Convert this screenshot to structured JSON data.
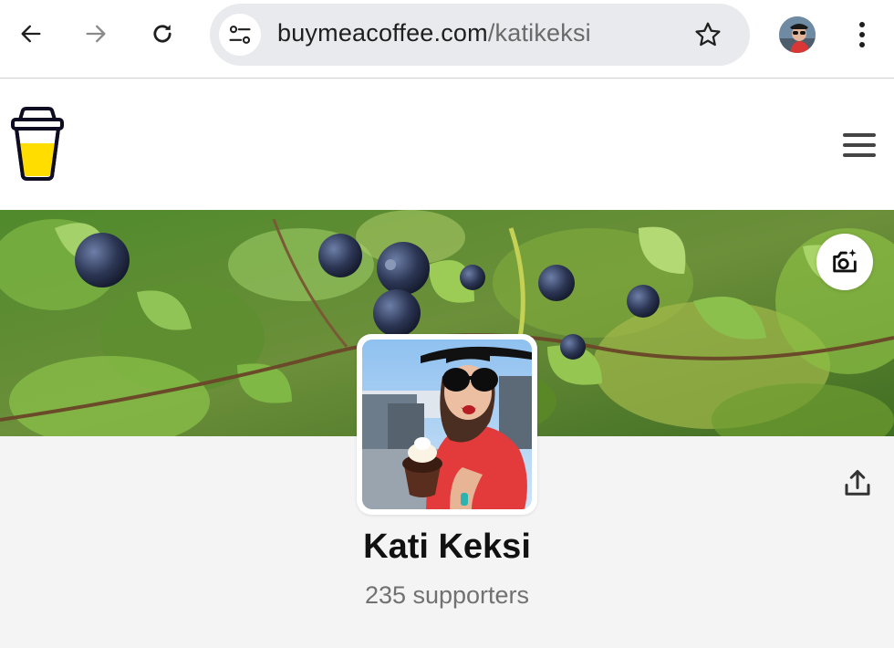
{
  "browser": {
    "url_domain": "buymeacoffee.com",
    "url_path": "/katikeksi",
    "icons": [
      "back-arrow-icon",
      "forward-arrow-icon",
      "reload-icon",
      "site-info-icon",
      "star-icon",
      "kebab-menu-icon"
    ]
  },
  "site": {
    "icons": [
      "buy-me-a-coffee-logo",
      "hamburger-menu-icon",
      "camera-add-icon",
      "share-icon"
    ]
  },
  "profile": {
    "name": "Kati Keksi",
    "supporters": "235 supporters"
  },
  "colors": {
    "page_bg": "#f4f4f4",
    "omnibox_bg": "#e9eaee",
    "logo_cup_yellow": "#ffdd00"
  }
}
